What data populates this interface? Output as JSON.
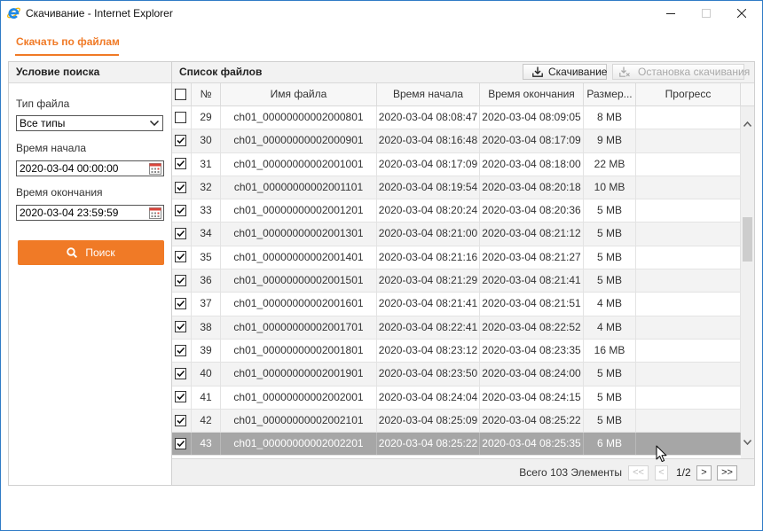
{
  "window": {
    "title": "Скачивание - Internet Explorer",
    "app_icon": "internet-explorer-icon",
    "controls": [
      "minimize-icon",
      "maximize-icon",
      "close-icon"
    ]
  },
  "tabs": [
    {
      "label": "Скачать по файлам",
      "active": true
    }
  ],
  "search": {
    "header": "Условие поиска",
    "file_type_label": "Тип файла",
    "file_type_value": "Все типы",
    "start_label": "Время начала",
    "start_value": "2020-03-04 00:00:00",
    "end_label": "Время окончания",
    "end_value": "2020-03-04 23:59:59",
    "button_label": "Поиск",
    "button_icon": "search-icon"
  },
  "files": {
    "header": "Список файлов",
    "download_label": "Скачивание",
    "stop_label": "Остановка скачивания",
    "stop_enabled": false,
    "columns": [
      "№",
      "Имя файла",
      "Время начала",
      "Время окончания",
      "Размер...",
      "Прогресс"
    ],
    "rows": [
      {
        "num": "29",
        "name": "ch01_00000000002000801",
        "start": "2020-03-04 08:08:47",
        "end": "2020-03-04 08:09:05",
        "size": "8 MB",
        "checked": false,
        "selected": false
      },
      {
        "num": "30",
        "name": "ch01_00000000002000901",
        "start": "2020-03-04 08:16:48",
        "end": "2020-03-04 08:17:09",
        "size": "9 MB",
        "checked": true,
        "selected": false
      },
      {
        "num": "31",
        "name": "ch01_00000000002001001",
        "start": "2020-03-04 08:17:09",
        "end": "2020-03-04 08:18:00",
        "size": "22 MB",
        "checked": true,
        "selected": false
      },
      {
        "num": "32",
        "name": "ch01_00000000002001101",
        "start": "2020-03-04 08:19:54",
        "end": "2020-03-04 08:20:18",
        "size": "10 MB",
        "checked": true,
        "selected": false
      },
      {
        "num": "33",
        "name": "ch01_00000000002001201",
        "start": "2020-03-04 08:20:24",
        "end": "2020-03-04 08:20:36",
        "size": "5 MB",
        "checked": true,
        "selected": false
      },
      {
        "num": "34",
        "name": "ch01_00000000002001301",
        "start": "2020-03-04 08:21:00",
        "end": "2020-03-04 08:21:12",
        "size": "5 MB",
        "checked": true,
        "selected": false
      },
      {
        "num": "35",
        "name": "ch01_00000000002001401",
        "start": "2020-03-04 08:21:16",
        "end": "2020-03-04 08:21:27",
        "size": "5 MB",
        "checked": true,
        "selected": false
      },
      {
        "num": "36",
        "name": "ch01_00000000002001501",
        "start": "2020-03-04 08:21:29",
        "end": "2020-03-04 08:21:41",
        "size": "5 MB",
        "checked": true,
        "selected": false
      },
      {
        "num": "37",
        "name": "ch01_00000000002001601",
        "start": "2020-03-04 08:21:41",
        "end": "2020-03-04 08:21:51",
        "size": "4 MB",
        "checked": true,
        "selected": false
      },
      {
        "num": "38",
        "name": "ch01_00000000002001701",
        "start": "2020-03-04 08:22:41",
        "end": "2020-03-04 08:22:52",
        "size": "4 MB",
        "checked": true,
        "selected": false
      },
      {
        "num": "39",
        "name": "ch01_00000000002001801",
        "start": "2020-03-04 08:23:12",
        "end": "2020-03-04 08:23:35",
        "size": "16 MB",
        "checked": true,
        "selected": false
      },
      {
        "num": "40",
        "name": "ch01_00000000002001901",
        "start": "2020-03-04 08:23:50",
        "end": "2020-03-04 08:24:00",
        "size": "5 MB",
        "checked": true,
        "selected": false
      },
      {
        "num": "41",
        "name": "ch01_00000000002002001",
        "start": "2020-03-04 08:24:04",
        "end": "2020-03-04 08:24:15",
        "size": "5 MB",
        "checked": true,
        "selected": false
      },
      {
        "num": "42",
        "name": "ch01_00000000002002101",
        "start": "2020-03-04 08:25:09",
        "end": "2020-03-04 08:25:22",
        "size": "5 MB",
        "checked": true,
        "selected": false
      },
      {
        "num": "43",
        "name": "ch01_00000000002002201",
        "start": "2020-03-04 08:25:22",
        "end": "2020-03-04 08:25:35",
        "size": "6 MB",
        "checked": true,
        "selected": true
      }
    ],
    "total": "Всего 103 Элементы",
    "pager": {
      "first": "<<",
      "prev": "<",
      "page": "1/2",
      "next": ">",
      "last": ">>",
      "first_enabled": false,
      "prev_enabled": false
    }
  },
  "colors": {
    "accent": "#f07a26",
    "selected_row": "#a6a6a6",
    "window_border": "#2f7bc6"
  }
}
